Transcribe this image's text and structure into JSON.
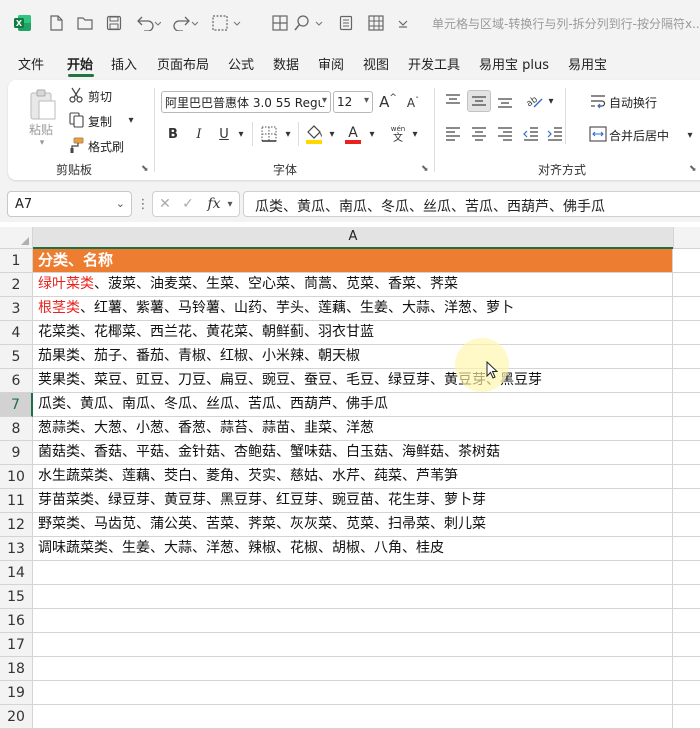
{
  "window": {
    "title": "单元格与区域-转换行与列-拆分列到行-按分隔符x..."
  },
  "icons": [
    "excel-logo-icon",
    "new-file-icon",
    "open-folder-icon",
    "save-icon",
    "undo-icon",
    "redo-icon",
    "border-icon",
    "search-icon",
    "form-icon",
    "grid-icon"
  ],
  "menu": {
    "items": [
      "文件",
      "开始",
      "插入",
      "页面布局",
      "公式",
      "数据",
      "审阅",
      "视图",
      "开发工具",
      "易用宝 plus",
      "易用宝"
    ],
    "active": "开始"
  },
  "ribbon": {
    "clipboard": {
      "paste": "粘贴",
      "cut": "剪切",
      "copy": "复制",
      "format_painter": "格式刷",
      "label": "剪贴板"
    },
    "font": {
      "font_name": "阿里巴巴普惠体 3.0 55 Regu",
      "font_size": "12",
      "grow": "A",
      "shrink": "A",
      "bold": "B",
      "italic": "I",
      "underline": "U",
      "phonetic_top": "wén",
      "phonetic_bottom": "文",
      "label": "字体",
      "fill_color": "#ffd800",
      "font_color": "#e8231e"
    },
    "alignment": {
      "wrap_text": "自动换行",
      "merge_center": "合并后居中",
      "label": "对齐方式"
    }
  },
  "formula_bar": {
    "name_box": "A7",
    "fx": "fx",
    "content": "瓜类、黄瓜、南瓜、冬瓜、丝瓜、苦瓜、西葫芦、佛手瓜"
  },
  "sheet": {
    "column_header": "A",
    "header_fill": "#ed7d31",
    "selected_row": 7,
    "rows": [
      {
        "num": "1",
        "prefix": "",
        "text": "分类、名称",
        "style": "header"
      },
      {
        "num": "2",
        "prefix": "绿叶菜类",
        "text": "、菠菜、油麦菜、生菜、空心菜、茼蒿、苋菜、香菜、荠菜",
        "style": "red-prefix"
      },
      {
        "num": "3",
        "prefix": "根茎类",
        "text": "、红薯、紫薯、马铃薯、山药、芋头、莲藕、生姜、大蒜、洋葱、萝卜",
        "style": "red-prefix"
      },
      {
        "num": "4",
        "prefix": "",
        "text": "花菜类、花椰菜、西兰花、黄花菜、朝鲜蓟、羽衣甘蓝",
        "style": ""
      },
      {
        "num": "5",
        "prefix": "",
        "text": "茄果类、茄子、番茄、青椒、红椒、小米辣、朝天椒",
        "style": ""
      },
      {
        "num": "6",
        "prefix": "",
        "text": "荚果类、菜豆、豇豆、刀豆、扁豆、豌豆、蚕豆、毛豆、绿豆芽、黄豆芽、黑豆芽",
        "style": ""
      },
      {
        "num": "7",
        "prefix": "",
        "text": "瓜类、黄瓜、南瓜、冬瓜、丝瓜、苦瓜、西葫芦、佛手瓜",
        "style": ""
      },
      {
        "num": "8",
        "prefix": "",
        "text": "葱蒜类、大葱、小葱、香葱、蒜苔、蒜苗、韭菜、洋葱",
        "style": ""
      },
      {
        "num": "9",
        "prefix": "",
        "text": "菌菇类、香菇、平菇、金针菇、杏鲍菇、蟹味菇、白玉菇、海鲜菇、茶树菇",
        "style": ""
      },
      {
        "num": "10",
        "prefix": "",
        "text": "水生蔬菜类、莲藕、茭白、菱角、芡实、慈姑、水芹、莼菜、芦苇笋",
        "style": ""
      },
      {
        "num": "11",
        "prefix": "",
        "text": "芽苗菜类、绿豆芽、黄豆芽、黑豆芽、红豆芽、豌豆苗、花生芽、萝卜芽",
        "style": ""
      },
      {
        "num": "12",
        "prefix": "",
        "text": "野菜类、马齿苋、蒲公英、苦菜、荠菜、灰灰菜、苋菜、扫帚菜、刺儿菜",
        "style": ""
      },
      {
        "num": "13",
        "prefix": "",
        "text": "调味蔬菜类、生姜、大蒜、洋葱、辣椒、花椒、胡椒、八角、桂皮",
        "style": ""
      },
      {
        "num": "14",
        "prefix": "",
        "text": "",
        "style": ""
      },
      {
        "num": "15",
        "prefix": "",
        "text": "",
        "style": ""
      },
      {
        "num": "16",
        "prefix": "",
        "text": "",
        "style": ""
      },
      {
        "num": "17",
        "prefix": "",
        "text": "",
        "style": ""
      },
      {
        "num": "18",
        "prefix": "",
        "text": "",
        "style": ""
      },
      {
        "num": "19",
        "prefix": "",
        "text": "",
        "style": ""
      },
      {
        "num": "20",
        "prefix": "",
        "text": "",
        "style": ""
      }
    ]
  }
}
